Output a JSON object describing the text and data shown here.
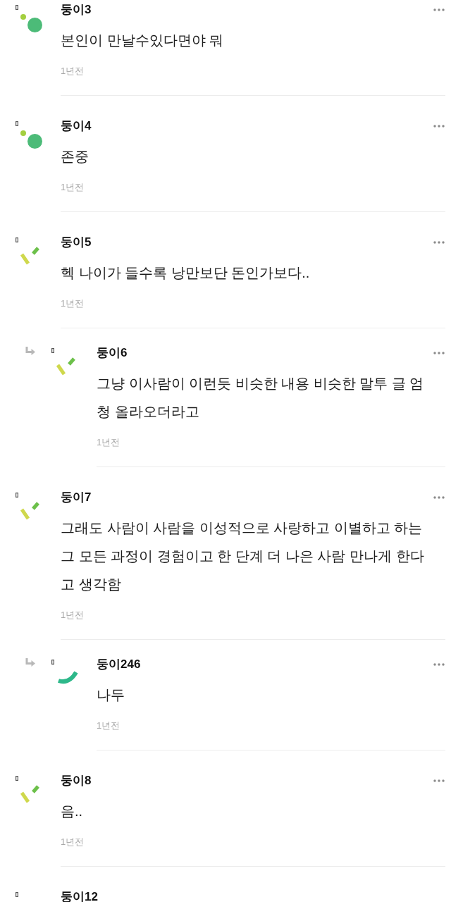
{
  "comments": [
    {
      "author": "둥이3",
      "more_menu": true,
      "avatar": {
        "kind": "dots"
      },
      "text": "본인이 만날수있다면야 뭐",
      "time": "1년전"
    },
    {
      "author": "둥이4",
      "more_menu": true,
      "avatar": {
        "kind": "dots"
      },
      "text": "존중",
      "time": "1년전"
    },
    {
      "author": "둥이5",
      "more_menu": true,
      "avatar": {
        "kind": "dashes"
      },
      "text": "헥 나이가 들수록 낭만보단 돈인가보다..",
      "time": "1년전",
      "children": [
        {
          "author": "둥이6",
          "more_menu": true,
          "avatar": {
            "kind": "dashes"
          },
          "text": "그냥 이사람이 이런듯 비슷한 내용 비슷한 말투 글 엄청 올라오더라고",
          "time": "1년전"
        }
      ]
    },
    {
      "author": "둥이7",
      "more_menu": true,
      "avatar": {
        "kind": "dashes"
      },
      "text": "그래도 사람이 사람을 이성적으로 사랑하고 이별하고 하는 그 모든 과정이 경험이고 한 단계 더 나은 사람 만나게 한다고 생각함",
      "time": "1년전",
      "children": [
        {
          "author": "둥이246",
          "more_menu": true,
          "avatar": {
            "kind": "arc"
          },
          "text": "나두",
          "time": "1년전"
        }
      ]
    },
    {
      "author": "둥이8",
      "more_menu": true,
      "avatar": {
        "kind": "dashes"
      },
      "text": "음..",
      "time": "1년전"
    },
    {
      "author": "둥이12",
      "more_menu": false
    }
  ]
}
